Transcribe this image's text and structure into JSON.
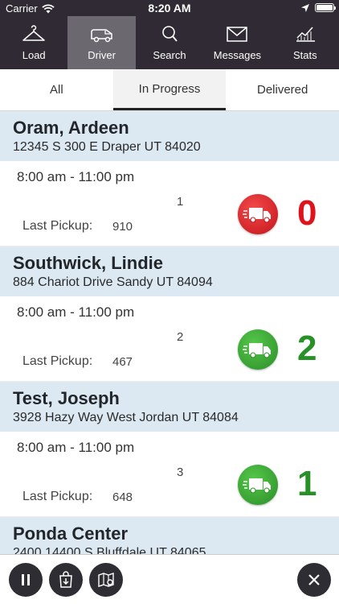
{
  "status_bar": {
    "carrier": "Carrier",
    "time": "8:20 AM"
  },
  "nav": [
    {
      "label": "Load",
      "icon": "hanger-icon"
    },
    {
      "label": "Driver",
      "icon": "van-icon",
      "active": true
    },
    {
      "label": "Search",
      "icon": "search-icon"
    },
    {
      "label": "Messages",
      "icon": "envelope-icon"
    },
    {
      "label": "Stats",
      "icon": "chart-icon"
    }
  ],
  "tabs": [
    {
      "label": "All"
    },
    {
      "label": "In Progress",
      "active": true
    },
    {
      "label": "Delivered"
    }
  ],
  "customers": [
    {
      "name": "Oram, Ardeen",
      "address": "12345 S 300 E Draper UT 84020",
      "window": "8:00 am - 11:00 pm",
      "stop": "1",
      "last_pickup_label": "Last Pickup:",
      "last_pickup": "910",
      "count": "0",
      "status_color": "#e0121b"
    },
    {
      "name": "Southwick, Lindie",
      "address": "884 Chariot Drive Sandy UT 84094",
      "window": "8:00 am - 11:00 pm",
      "stop": "2",
      "last_pickup_label": "Last Pickup:",
      "last_pickup": "467",
      "count": "2",
      "status_color": "#279128"
    },
    {
      "name": "Test, Joseph",
      "address": "3928 Hazy Way West Jordan UT 84084",
      "window": "8:00 am - 11:00 pm",
      "stop": "3",
      "last_pickup_label": "Last Pickup:",
      "last_pickup": "648",
      "count": "1",
      "status_color": "#279128"
    },
    {
      "name": "Ponda Center",
      "address": "2400 14400 S Bluffdale UT 84065"
    }
  ],
  "bottom_bar": {
    "buttons": [
      "pause-icon",
      "bag-download-icon",
      "map-pin-icon",
      "close-icon"
    ]
  }
}
